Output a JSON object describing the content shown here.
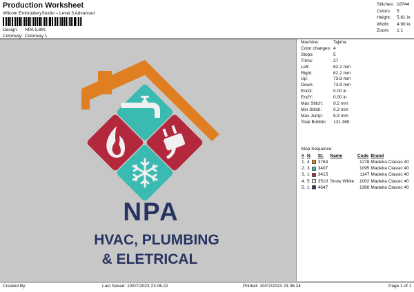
{
  "header": {
    "title": "Production Worksheet",
    "subtitle": "Wilcom EmbroideryStudio – Level 3 Advanced",
    "design_label": "Design:",
    "design_value": "NPA 5,8IN",
    "colorway_label": "Colorway:",
    "colorway_value": "Colorway 1"
  },
  "summary": {
    "stitches_label": "Stitches:",
    "stitches_value": "18744",
    "colors_label": "Colors:",
    "colors_value": "5",
    "height_label": "Height:",
    "height_value": "5.81 in",
    "width_label": "Width:",
    "width_value": "4.90 in",
    "zoom_label": "Zoom:",
    "zoom_value": "1:1"
  },
  "machine_info": [
    {
      "label": "Machine:",
      "value": "Tajima"
    },
    {
      "label": "Color changes:",
      "value": "4"
    },
    {
      "label": "Stops:",
      "value": "5"
    },
    {
      "label": "Trims:",
      "value": "27"
    },
    {
      "label": "Left:",
      "value": "62.2 mm"
    },
    {
      "label": "Right:",
      "value": "62.2 mm"
    },
    {
      "label": "Up:",
      "value": "73.8 mm"
    },
    {
      "label": "Down:",
      "value": "73.8 mm"
    },
    {
      "label": "EndX:",
      "value": "0.00 in"
    },
    {
      "label": "EndY:",
      "value": "0.00 in"
    },
    {
      "label": "Max Stitch:",
      "value": "9.2 mm"
    },
    {
      "label": "Min Stitch:",
      "value": "0.3 mm"
    },
    {
      "label": "Max Jump:",
      "value": "6.9 mm"
    },
    {
      "label": "Total Bobbin:",
      "value": "131.36ft"
    }
  ],
  "stop_sequence": {
    "label": "Stop Sequence:",
    "headers": [
      "#",
      "N",
      "St.",
      "Name",
      "Code",
      "Brand"
    ],
    "rows": [
      {
        "index": "1.",
        "n": "4",
        "color": "#e07f22",
        "st": "3763",
        "name": "",
        "code": "1278",
        "brand": "Madeira Classic 40"
      },
      {
        "index": "2.",
        "n": "3",
        "color": "#3bbab2",
        "st": "3407",
        "name": "",
        "code": "1095",
        "brand": "Madeira Classic 40"
      },
      {
        "index": "3.",
        "n": "1",
        "color": "#b3283c",
        "st": "3415",
        "name": "",
        "code": "1147",
        "brand": "Madeira Classic 40"
      },
      {
        "index": "4.",
        "n": "5",
        "color": "#f0f0f0",
        "st": "3510",
        "name": "Snow White",
        "code": "1002",
        "brand": "Madeira Classic 40"
      },
      {
        "index": "5.",
        "n": "1",
        "color": "#273461",
        "st": "4647",
        "name": "",
        "code": "1366",
        "brand": "Madeira Classic 40"
      }
    ]
  },
  "design": {
    "line1": "NPA",
    "line2": "HVAC, PLUMBING",
    "line3": "& ELETRICAL",
    "colors": {
      "orange": "#e07f22",
      "teal": "#3bbab2",
      "red": "#b3283c",
      "white": "#f0f0f0",
      "navy": "#273461",
      "background": "#c7c7c7"
    }
  },
  "footer": {
    "created_by": "Created By:",
    "last_saved": "Last Saved: 10/07/2023 23.06.22",
    "printed": "Printed: 10/07/2023 23.06.24",
    "page": "Page 1 of 1"
  }
}
